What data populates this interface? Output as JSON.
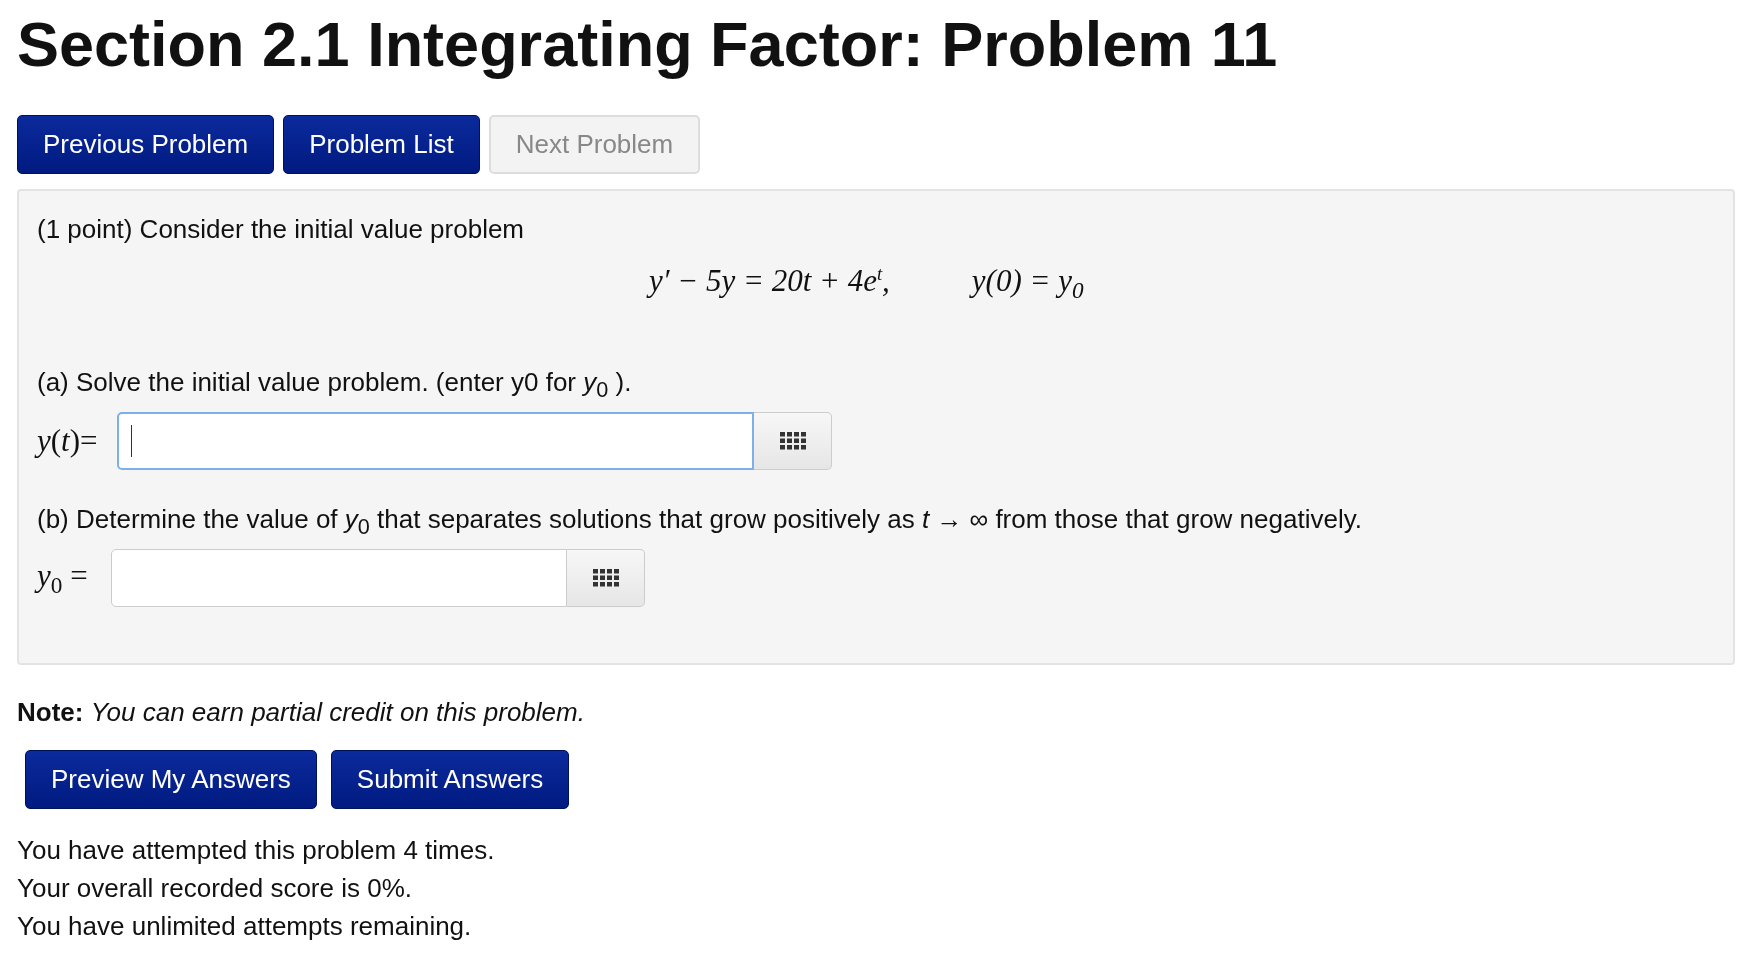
{
  "title": "Section 2.1 Integrating Factor: Problem 11",
  "nav_buttons": [
    {
      "label": "Previous Problem",
      "disabled": false
    },
    {
      "label": "Problem List",
      "disabled": false
    },
    {
      "label": "Next Problem",
      "disabled": true
    }
  ],
  "problem": {
    "intro": "(1 point) Consider the initial value problem",
    "equation": [
      "y′ − 5y = 20t + 4e$^{t}$,",
      "y(0) = y$_{0}$"
    ],
    "parts": [
      {
        "text": "(a) Solve the initial value problem. (enter y0 for *y*$_{0}$ ).",
        "answer_label": "*y*(*t*)=",
        "focused": true
      },
      {
        "text": "(b) Determine the value of *y*$_{0}$  that separates solutions that grow positively as *t* → ∞ from those that grow negatively.",
        "answer_label": "*y*$_{0}$ =",
        "focused": false
      }
    ]
  },
  "note": {
    "label": "Note:",
    "text": "You can earn partial credit on this problem."
  },
  "submit_buttons": [
    "Preview My Answers",
    "Submit Answers"
  ],
  "status_lines": [
    "You have attempted this problem 4 times.",
    "Your overall recorded score is 0%.",
    "You have unlimited attempts remaining."
  ]
}
